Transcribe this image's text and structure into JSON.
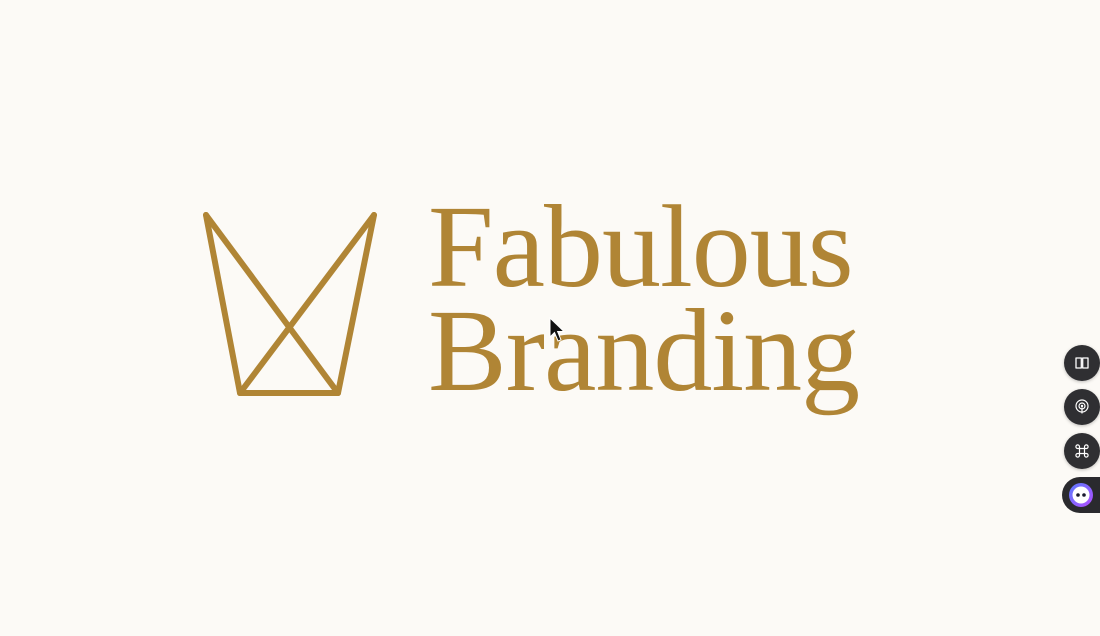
{
  "brand": {
    "name_line1": "Fabulous",
    "name_line2": "Branding",
    "color": "#b08535"
  },
  "side_tools": {
    "items": [
      {
        "icon": "book-icon"
      },
      {
        "icon": "podcast-icon"
      },
      {
        "icon": "command-icon"
      },
      {
        "icon": "assistant-face-icon"
      }
    ]
  },
  "background_color": "#fcfaf6"
}
